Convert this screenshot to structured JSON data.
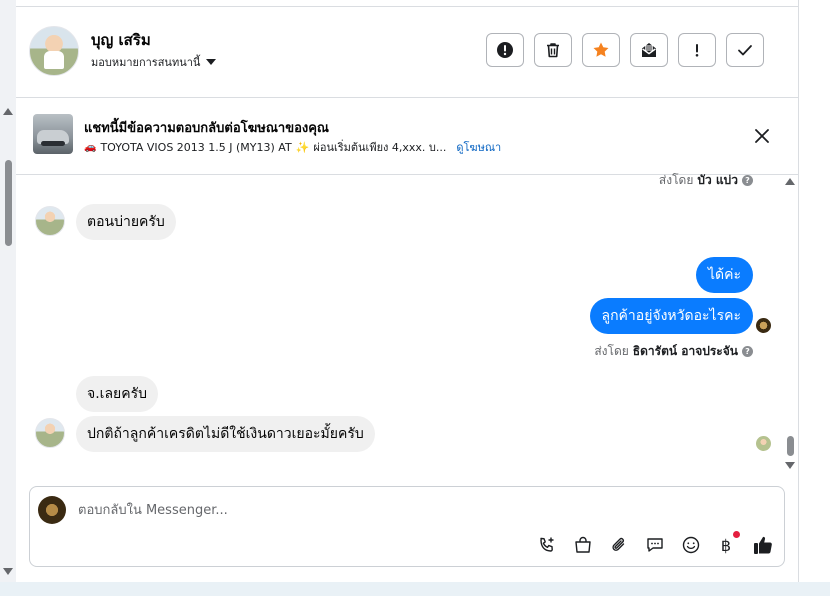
{
  "header": {
    "contact_name": "บุญ เสริม",
    "assign_label": "มอบหมายการสนทนานี้"
  },
  "toolbar": {
    "buttons": [
      "spam",
      "delete",
      "star",
      "mark-unread",
      "follow-up",
      "done"
    ],
    "star_color": "#f5821f"
  },
  "ad_banner": {
    "title": "แชทนี้มีข้อความตอบกลับต่อโฆษณาของคุณ",
    "car_emoji": "🚗",
    "description": "TOYOTA VIOS 2013 1.5 J (MY13) AT",
    "sparkle": "✨",
    "description_tail": "ผ่อนเริ่มต้นเพียง 4,xxx. บ...",
    "link": "ดูโฆษณา"
  },
  "chat": {
    "sent_by_prefix_1": "ส่งโดย",
    "sent_by_name_1": "บัว แบ่ว",
    "msg_in_1": "ตอนบ่ายครับ",
    "msg_out_1": "ได้ค่ะ",
    "msg_out_2": "ลูกค้าอยู่จังหวัดอะไรคะ",
    "sent_by_prefix_2": "ส่งโดย",
    "sent_by_name_2": "ธิดารัตน์ อาจประจัน",
    "msg_in_2": "จ.เลยครับ",
    "msg_in_3": "ปกติถ้าลูกค้าเครดิตไม่ดีใช้เงินดาวเยอะมั้ยครับ",
    "help_glyph": "?"
  },
  "composer": {
    "placeholder": "ตอบกลับใน Messenger...",
    "icons": [
      "call-add",
      "shop-bag",
      "attachment",
      "saved-reply",
      "emoji",
      "baht-payment",
      "like"
    ],
    "baht_glyph": "฿",
    "accent": "#0a7cff"
  }
}
